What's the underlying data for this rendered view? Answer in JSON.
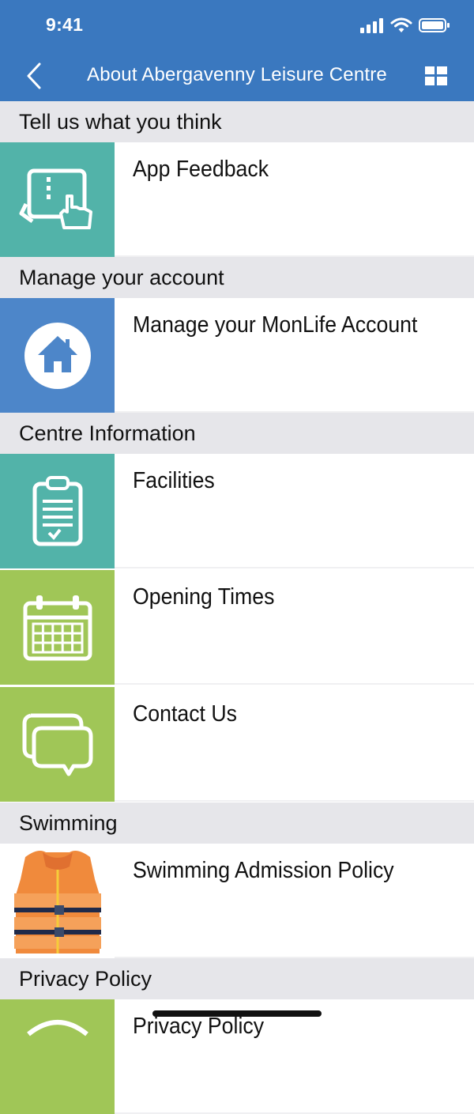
{
  "status_bar": {
    "time": "9:41"
  },
  "nav": {
    "title": "About Abergavenny Leisure Centre"
  },
  "colors": {
    "header_blue": "#3a78bf",
    "teal": "#52b3a9",
    "blue": "#4d86c9",
    "green": "#a0c657",
    "section_bg": "#e6e6ea"
  },
  "sections": [
    {
      "header": "Tell us what you think",
      "items": [
        {
          "label": "App Feedback",
          "icon": "tablet-touch-icon"
        }
      ]
    },
    {
      "header": "Manage your account",
      "items": [
        {
          "label": "Manage your MonLife Account",
          "icon": "home-icon"
        }
      ]
    },
    {
      "header": "Centre Information",
      "items": [
        {
          "label": "Facilities",
          "icon": "clipboard-icon"
        },
        {
          "label": "Opening Times",
          "icon": "calendar-icon"
        },
        {
          "label": "Contact Us",
          "icon": "chat-bubbles-icon"
        }
      ]
    },
    {
      "header": "Swimming",
      "items": [
        {
          "label": "Swimming Admission Policy",
          "icon": "life-vest-icon"
        }
      ]
    },
    {
      "header": "Privacy Policy",
      "items": [
        {
          "label": "Privacy Policy",
          "icon": "privacy-icon"
        }
      ]
    }
  ]
}
